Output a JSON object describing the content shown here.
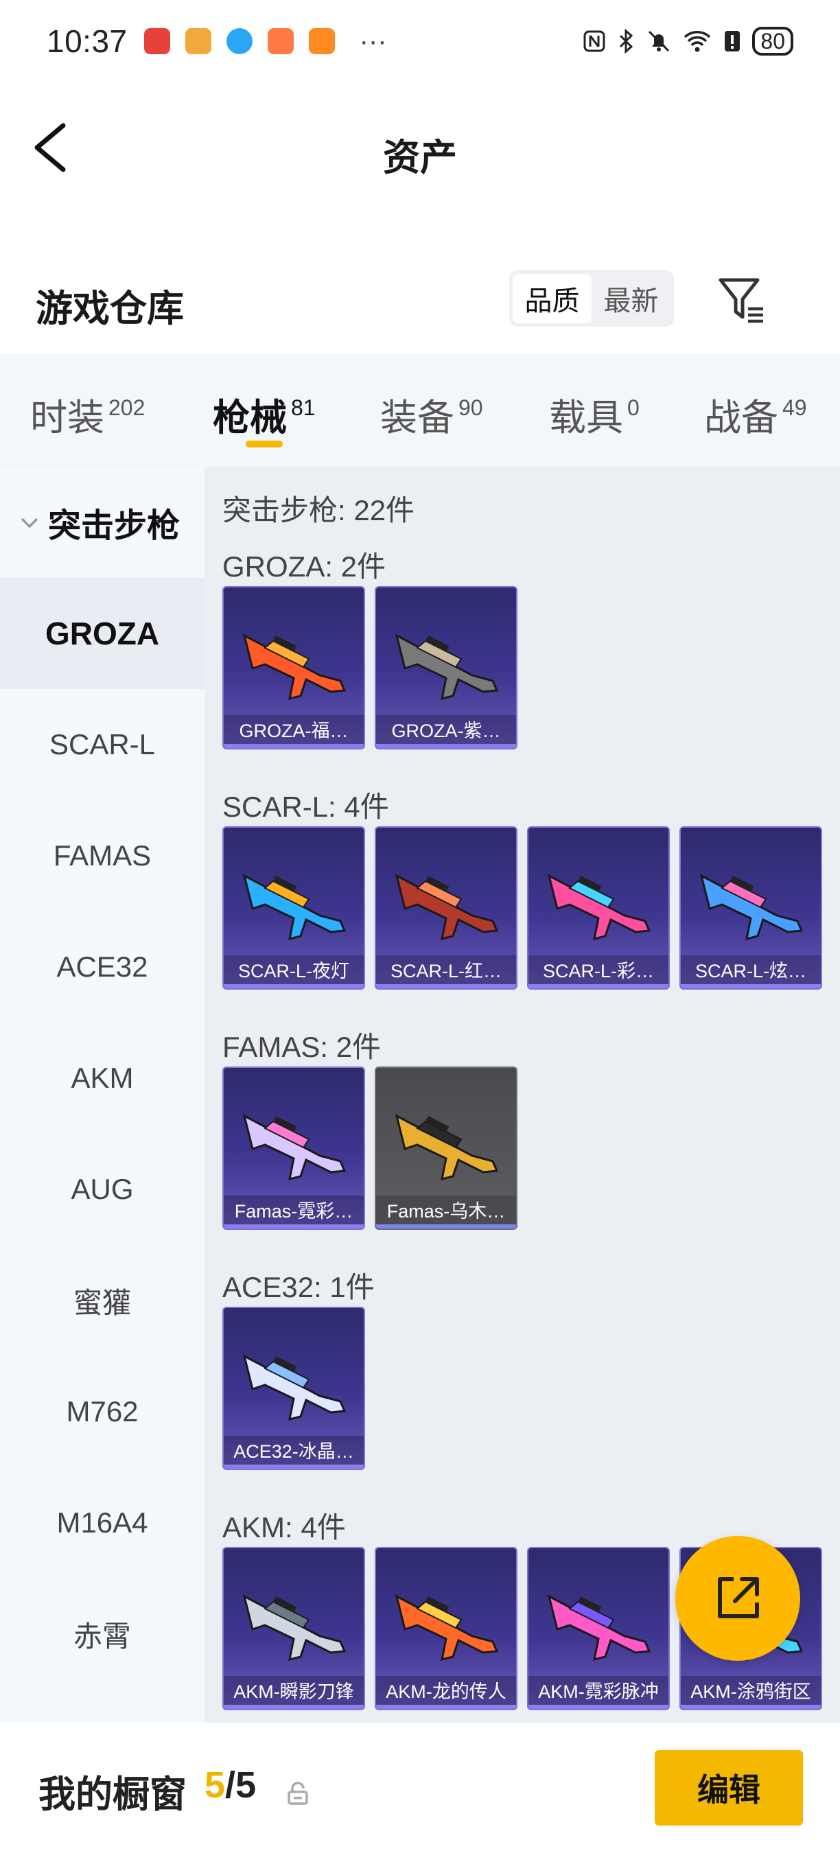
{
  "status_bar": {
    "time": "10:37",
    "battery": "80",
    "more": "···",
    "app_icon_colors": [
      "#e8413c",
      "#f2a93b",
      "#2aa6f2",
      "#ff7a45",
      "#ff8a1f"
    ]
  },
  "header": {
    "title": "资产",
    "back_icon": "chevron-left-icon"
  },
  "warehouse": {
    "title": "游戏仓库",
    "sort_options": [
      "品质",
      "最新"
    ],
    "active_sort": "品质",
    "filter_icon": "filter-icon"
  },
  "tabs": [
    {
      "label": "时装",
      "count": "202"
    },
    {
      "label": "枪械",
      "count": "81"
    },
    {
      "label": "装备",
      "count": "90"
    },
    {
      "label": "载具",
      "count": "0"
    },
    {
      "label": "战备",
      "count": "49"
    }
  ],
  "active_tab": "枪械",
  "sidebar": {
    "group": "突击步枪",
    "items": [
      "GROZA",
      "SCAR-L",
      "FAMAS",
      "ACE32",
      "AKM",
      "AUG",
      "蜜獾",
      "M762",
      "M16A4",
      "赤霄"
    ],
    "active": "GROZA"
  },
  "content": {
    "summary": "突击步枪: 22件",
    "sections": [
      {
        "label": "GROZA: 2件",
        "items": [
          "GROZA-福…",
          "GROZA-紫…"
        ]
      },
      {
        "label": "SCAR-L: 4件",
        "items": [
          "SCAR-L-夜灯",
          "SCAR-L-红…",
          "SCAR-L-彩…",
          "SCAR-L-炫…"
        ]
      },
      {
        "label": "FAMAS: 2件",
        "items": [
          "Famas-霓彩…",
          "Famas-乌木…"
        ]
      },
      {
        "label": "ACE32: 1件",
        "items": [
          "ACE32-冰晶…"
        ]
      },
      {
        "label": "AKM: 4件",
        "items": [
          "AKM-瞬影刀锋",
          "AKM-龙的传人",
          "AKM-霓彩脉冲",
          "AKM-涂鸦街区"
        ]
      }
    ]
  },
  "bottom_bar": {
    "title": "我的橱窗",
    "current": "5",
    "separator": "/",
    "total": "5",
    "edit_label": "编辑"
  },
  "colors": {
    "accent": "#f5b800",
    "card_purple": "#3e3690",
    "card_grey": "#5d5d63"
  }
}
